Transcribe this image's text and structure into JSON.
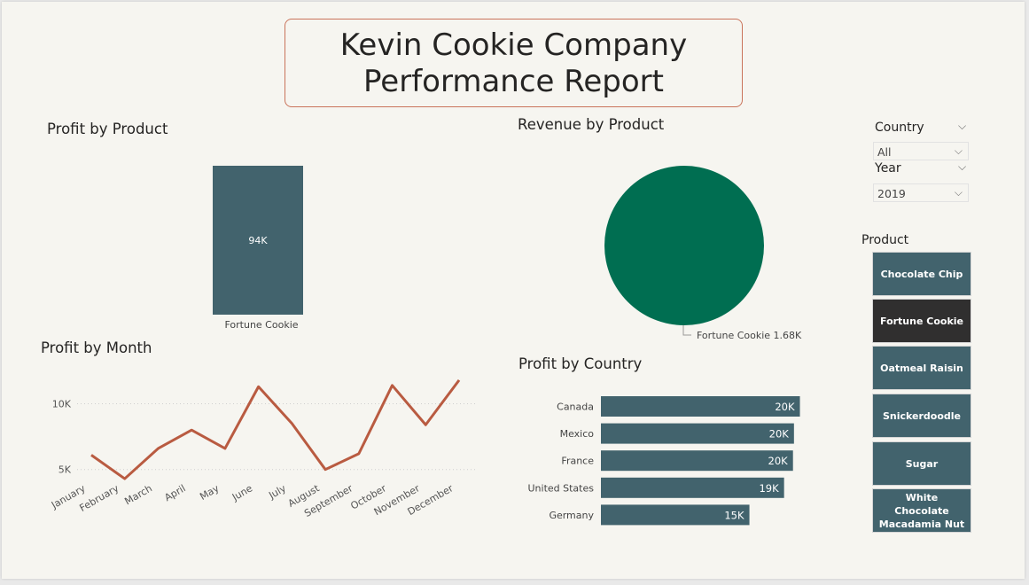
{
  "report": {
    "title_line1": "Kevin Cookie Company",
    "title_line2": "Performance Report",
    "border_color": "#c9735a"
  },
  "slicers": {
    "country": {
      "label": "Country",
      "value": "All"
    },
    "year": {
      "label": "Year",
      "value": "2019"
    },
    "product": {
      "label": "Product",
      "options": [
        "Chocolate Chip",
        "Fortune Cookie",
        "Oatmeal Raisin",
        "Snickerdoodle",
        "Sugar",
        "White Chocolate Macadamia Nut"
      ],
      "selected": "Fortune Cookie",
      "tile_color": "#42636d",
      "selected_color": "#302f2f"
    }
  },
  "chart_data": [
    {
      "id": "profit_by_product",
      "type": "bar",
      "title": "Profit by Product",
      "categories": [
        "Fortune Cookie"
      ],
      "values": [
        94000
      ],
      "data_labels": [
        "94K"
      ],
      "color": "#42636d"
    },
    {
      "id": "revenue_by_product",
      "type": "pie",
      "title": "Revenue by Product",
      "labels": [
        "Fortune Cookie"
      ],
      "values": [
        1680
      ],
      "data_labels": [
        "Fortune Cookie 1.68K"
      ],
      "color": "#006e51"
    },
    {
      "id": "profit_by_month",
      "type": "line",
      "title": "Profit by Month",
      "x": [
        "January",
        "February",
        "March",
        "April",
        "May",
        "June",
        "July",
        "August",
        "September",
        "October",
        "November",
        "December"
      ],
      "values": [
        6100,
        4300,
        6600,
        8000,
        6600,
        11300,
        8500,
        5000,
        6200,
        11400,
        8400,
        11800
      ],
      "y_ticks": [
        5000,
        10000
      ],
      "y_tick_labels": [
        "5K",
        "10K"
      ],
      "ylim": [
        3900,
        12600
      ],
      "color": "#b95b41"
    },
    {
      "id": "profit_by_country",
      "type": "bar",
      "orientation": "horizontal",
      "title": "Profit by Country",
      "categories": [
        "Canada",
        "Mexico",
        "France",
        "United States",
        "Germany"
      ],
      "values": [
        20100,
        19500,
        19400,
        18500,
        15000
      ],
      "data_labels": [
        "20K",
        "20K",
        "20K",
        "19K",
        "15K"
      ],
      "xlim": [
        0,
        20500
      ],
      "color": "#42636d"
    }
  ]
}
